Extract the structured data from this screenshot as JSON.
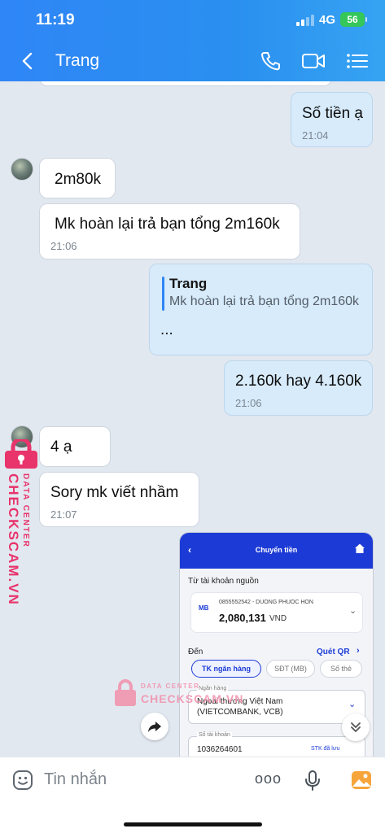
{
  "status_bar": {
    "time": "11:19",
    "network": "4G",
    "battery": "56"
  },
  "header": {
    "title": "Trang",
    "back_icon": "chevron-left-icon",
    "call_icon": "phone-icon",
    "video_icon": "video-camera-icon",
    "menu_icon": "list-menu-icon"
  },
  "messages": [
    {
      "from": "me",
      "text": "Số tiền ạ",
      "time": "21:04"
    },
    {
      "from": "them",
      "text": "2m80k"
    },
    {
      "from": "them",
      "text": "Mk hoàn lại trả bạn tổng  2m160k",
      "time": "21:06"
    },
    {
      "from": "me",
      "quote_name": "Trang",
      "quote_text": "Mk hoàn lại trả bạn tổng  2m160k",
      "text": "..."
    },
    {
      "from": "me",
      "text": "2.160k hay 4.160k",
      "time": "21:06"
    },
    {
      "from": "them",
      "text": "4 ạ"
    },
    {
      "from": "them",
      "text": "Sory  mk viết nhầm",
      "time": "21:07"
    }
  ],
  "transfer_screenshot": {
    "header_title": "Chuyển tiền",
    "source_label": "Từ tài khoản nguồn",
    "bank_tag": "MB",
    "account_line": "0855552542 - DUONG PHUOC HON",
    "balance": "2,080,131",
    "currency": "VND",
    "to_label": "Đến",
    "qr_link": "Quét QR",
    "tabs": [
      "TK ngân hàng",
      "SĐT (MB)",
      "Số thẻ"
    ],
    "bank_field_label": "Ngân hàng",
    "bank_value_line1": "Ngoai thương Việt Nam",
    "bank_value_line2": "(VIETCOMBANK, VCB)",
    "account_field_label": "Số tài khoản",
    "account_number": "1036264601",
    "saved_label": "STK đã lưu"
  },
  "watermark": {
    "side_label": "DATA CENTER",
    "side_brand": "CHECKSCAM.VN",
    "mid_label": "DATA CENTER",
    "mid_brand": "CHECKSCAM.VN"
  },
  "input": {
    "placeholder": "Tin nhắn",
    "more_label": "ooo"
  },
  "colors": {
    "header_blue": "#2f86f6",
    "bubble_me": "#d7ebfb",
    "bank_blue": "#1c3bd6",
    "watermark_pink": "#e8336b"
  }
}
